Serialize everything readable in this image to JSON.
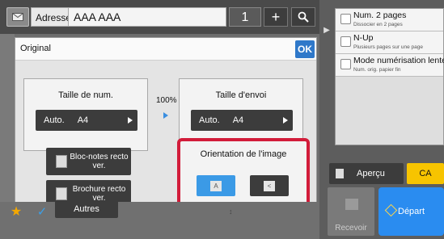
{
  "address_bar": {
    "label": "Adresse",
    "value": "AAA AAA",
    "count": "1",
    "plus": "+"
  },
  "panel": {
    "title": "Original",
    "ok_label": "OK",
    "scan_size": {
      "title": "Taille de num.",
      "mode": "Auto.",
      "size": "A4"
    },
    "ratio": "100%",
    "send_size": {
      "title": "Taille d'envoi",
      "mode": "Auto.",
      "size": "A4"
    },
    "bindings": [
      {
        "label": "Bloc-notes recto ver."
      },
      {
        "label": "Brochure recto ver."
      }
    ],
    "orientation": {
      "title": "Orientation de l'image",
      "selected": "portrait"
    }
  },
  "bottom_bar": {
    "others_label": "Autres"
  },
  "right_panel": {
    "options": [
      {
        "title": "Num. 2 pages",
        "subtitle": "Dissocier en 2 pages"
      },
      {
        "title": "N-Up",
        "subtitle": "Plusieurs pages sur une page"
      },
      {
        "title": "Mode numérisation lente",
        "subtitle": "Num. orig. papier fin"
      }
    ],
    "preview_label": "Aperçu",
    "ca_label": "CA",
    "receive_label": "Recevoir",
    "start_label": "Départ"
  },
  "colors": {
    "accent_blue": "#2a8cf0",
    "highlight_red": "#d21c3a",
    "ca_yellow": "#f7c400"
  }
}
